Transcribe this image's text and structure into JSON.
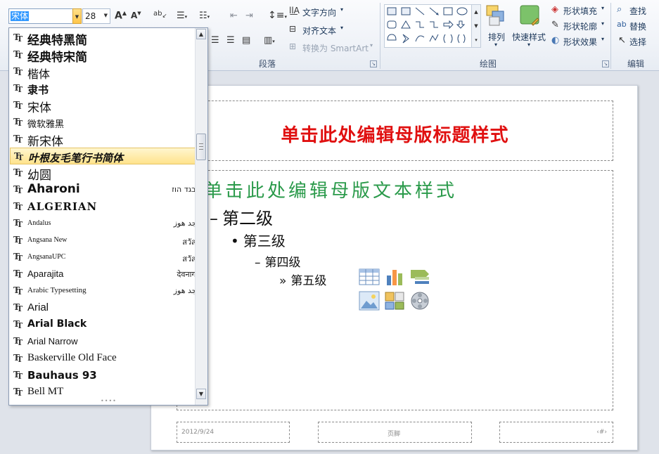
{
  "ribbon": {
    "font_name": "宋体",
    "font_size": "28",
    "text_direction": "文字方向",
    "align_text": "对齐文本",
    "convert_smartart": "转换为 SmartArt",
    "arrange": "排列",
    "quick_styles": "快速样式",
    "shape_fill": "形状填充",
    "shape_outline": "形状轮廓",
    "shape_effects": "形状效果",
    "find": "查找",
    "replace": "替换",
    "select": "选择",
    "group_paragraph": "段落",
    "group_drawing": "绘图",
    "group_editing": "编辑"
  },
  "font_list": [
    {
      "name": "经典特黑简",
      "sample": ""
    },
    {
      "name": "经典特宋简",
      "sample": ""
    },
    {
      "name": "楷体",
      "sample": ""
    },
    {
      "name": "隶书",
      "sample": ""
    },
    {
      "name": "宋体",
      "sample": ""
    },
    {
      "name": "微软雅黑",
      "sample": ""
    },
    {
      "name": "新宋体",
      "sample": ""
    },
    {
      "name": "叶根友毛笔行书简体",
      "sample": ""
    },
    {
      "name": "幼圆",
      "sample": ""
    },
    {
      "name": "Aharoni",
      "sample": "אבגד הוז"
    },
    {
      "name": "ALGERIAN",
      "sample": ""
    },
    {
      "name": "Andalus",
      "sample": "أيجد هوز"
    },
    {
      "name": "Angsana New",
      "sample": "สวัสดี"
    },
    {
      "name": "AngsanaUPC",
      "sample": "สวัสดี"
    },
    {
      "name": "Aparajita",
      "sample": "देवनागरी"
    },
    {
      "name": "Arabic Typesetting",
      "sample": "أيجد هوز"
    },
    {
      "name": "Arial",
      "sample": ""
    },
    {
      "name": "Arial Black",
      "sample": ""
    },
    {
      "name": "Arial Narrow",
      "sample": ""
    },
    {
      "name": "Baskerville Old Face",
      "sample": ""
    },
    {
      "name": "Bauhaus 93",
      "sample": ""
    },
    {
      "name": "Bell MT",
      "sample": ""
    }
  ],
  "slide": {
    "title": "单击此处编辑母版标题样式",
    "level1": "单击此处编辑母版文本样式",
    "level2": "第二级",
    "level3": "第三级",
    "level4": "第四级",
    "level5": "第五级",
    "bullet_dash": "–",
    "bullet_dot": "•",
    "bullet_raquo": "»",
    "footer_date": "2012/9/24",
    "footer_center": "页脚",
    "footer_page": "‹#›"
  }
}
